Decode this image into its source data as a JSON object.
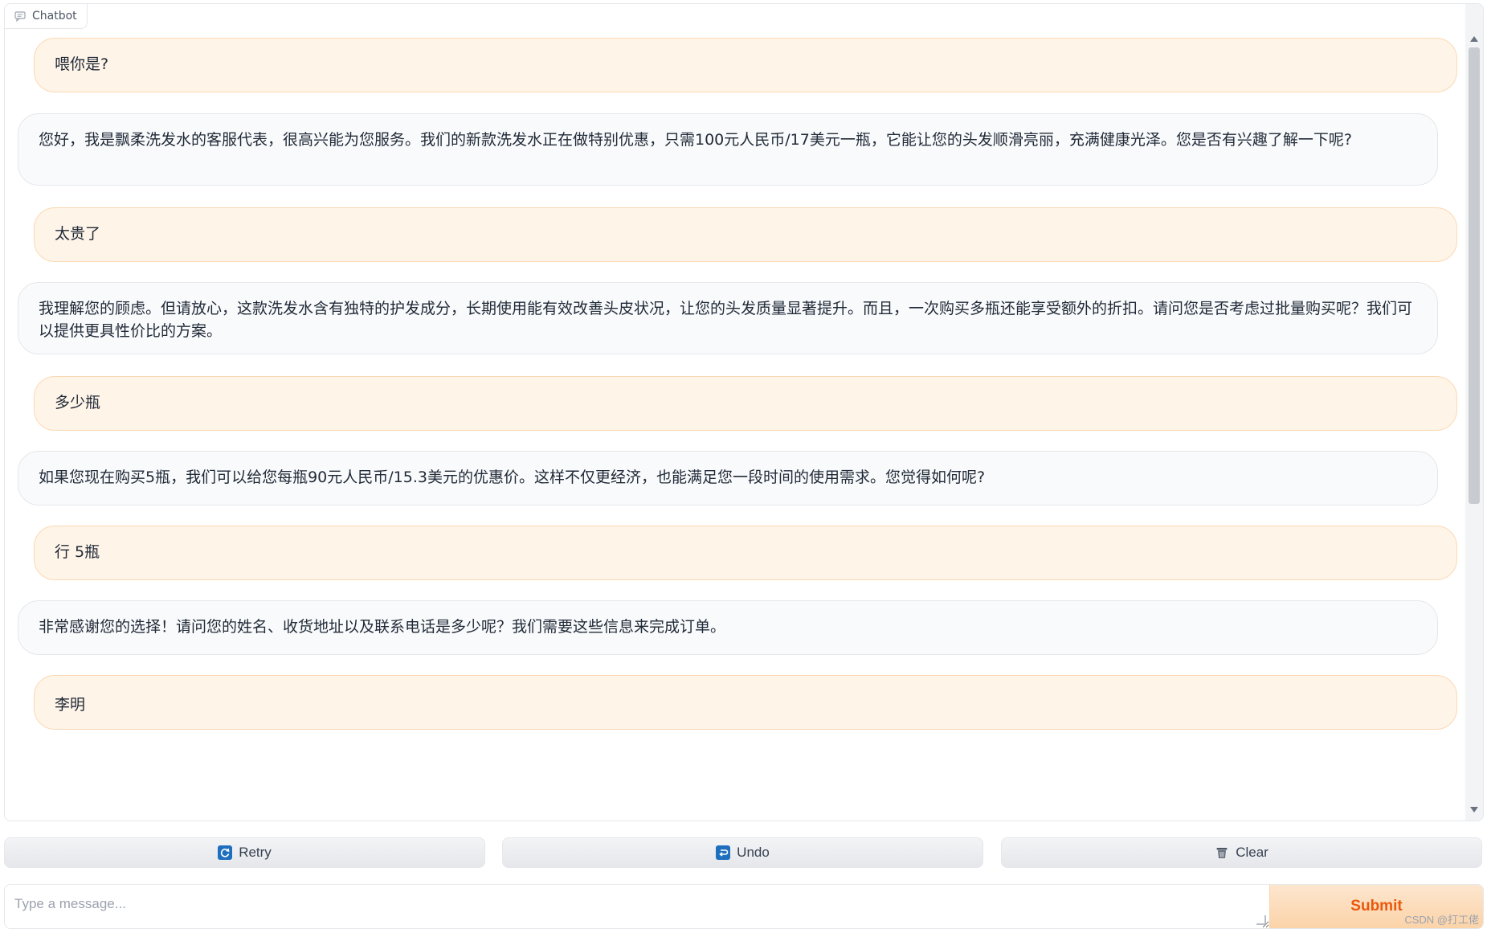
{
  "panel": {
    "label": "Chatbot",
    "icon": "chat-icon"
  },
  "messages": [
    {
      "role": "user",
      "text": "喂你是?"
    },
    {
      "role": "bot",
      "text": "您好，我是飘柔洗发水的客服代表，很高兴能为您服务。我们的新款洗发水正在做特别优惠，只需100元人民币/17美元一瓶，它能让您的头发顺滑亮丽，充满健康光泽。您是否有兴趣了解一下呢?"
    },
    {
      "role": "user",
      "text": "太贵了"
    },
    {
      "role": "bot",
      "text": "我理解您的顾虑。但请放心，这款洗发水含有独特的护发成分，长期使用能有效改善头皮状况，让您的头发质量显著提升。而且，一次购买多瓶还能享受额外的折扣。请问您是否考虑过批量购买呢？我们可以提供更具性价比的方案。"
    },
    {
      "role": "user",
      "text": "多少瓶"
    },
    {
      "role": "bot",
      "text": "如果您现在购买5瓶，我们可以给您每瓶90元人民币/15.3美元的优惠价。这样不仅更经济，也能满足您一段时间的使用需求。您觉得如何呢?"
    },
    {
      "role": "user",
      "text": "行 5瓶"
    },
    {
      "role": "bot",
      "text": "非常感谢您的选择！请问您的姓名、收货地址以及联系电话是多少呢？我们需要这些信息来完成订单。"
    },
    {
      "role": "user",
      "text": "李明"
    }
  ],
  "buttons": {
    "retry": {
      "label": "Retry",
      "icon": "retry-icon"
    },
    "undo": {
      "label": "Undo",
      "icon": "undo-icon"
    },
    "clear": {
      "label": "Clear",
      "icon": "trash-icon"
    }
  },
  "input": {
    "placeholder": "Type a message...",
    "value": ""
  },
  "submit": {
    "label": "Submit"
  },
  "watermark": "CSDN @打工佬",
  "colors": {
    "user_bubble": "#fff4e8",
    "bot_bubble": "#f9fafb",
    "accent": "#ea580c"
  }
}
